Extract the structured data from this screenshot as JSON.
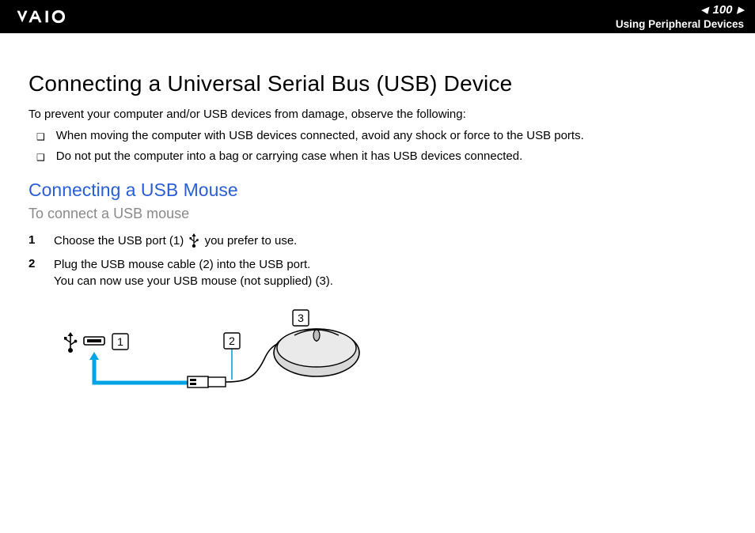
{
  "header": {
    "page_number": "100",
    "section": "Using Peripheral Devices"
  },
  "title": "Connecting a Universal Serial Bus (USB) Device",
  "intro": "To prevent your computer and/or USB devices from damage, observe the following:",
  "bullets": [
    "When moving the computer with USB devices connected, avoid any shock or force to the USB ports.",
    "Do not put the computer into a bag or carrying case when it has USB devices connected."
  ],
  "subsection_title": "Connecting a USB Mouse",
  "subsection_subhead": "To connect a USB mouse",
  "steps": [
    {
      "num": "1",
      "text_before": "Choose the USB port (1) ",
      "text_after": " you prefer to use."
    },
    {
      "num": "2",
      "text_before": "Plug the USB mouse cable (2) into the USB port.\nYou can now use your USB mouse (not supplied) (3).",
      "text_after": ""
    }
  ],
  "diagram": {
    "callouts": [
      "1",
      "2",
      "3"
    ]
  }
}
